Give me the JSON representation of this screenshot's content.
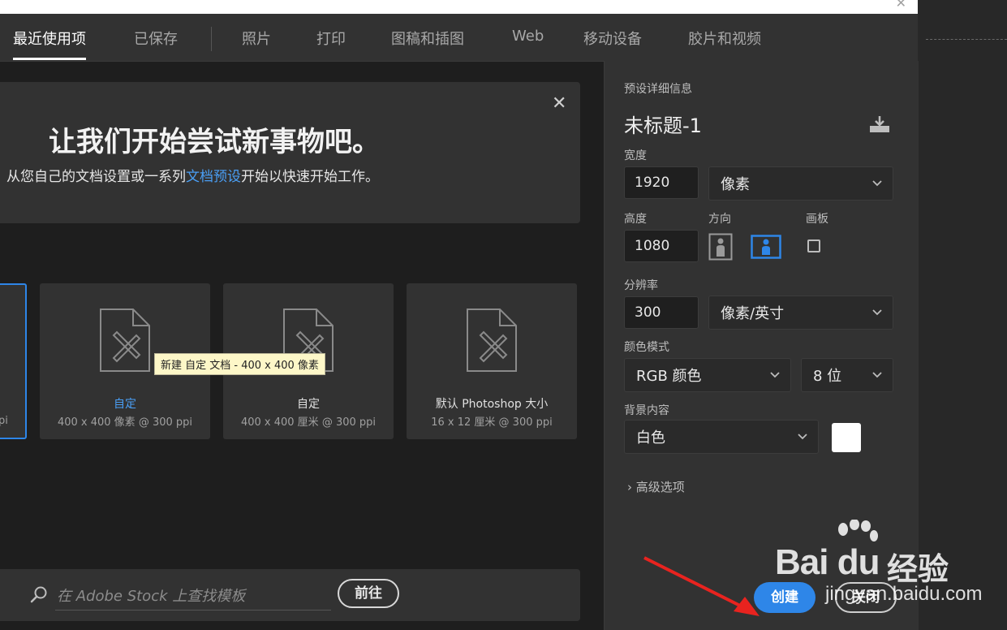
{
  "tabs": [
    {
      "label": "最近使用项",
      "active": true
    },
    {
      "label": "已保存"
    },
    {
      "label": "照片"
    },
    {
      "label": "打印"
    },
    {
      "label": "图稿和插图"
    },
    {
      "label": "Web"
    },
    {
      "label": "移动设备"
    },
    {
      "label": "胶片和视频"
    }
  ],
  "welcome": {
    "title": "让我们开始尝试新事物吧。",
    "subtitle_before": "从您自己的文档设置或一系列",
    "subtitle_link": "文档预设",
    "subtitle_after": "开始以快速开始工作。"
  },
  "presets": [
    {
      "partial_dim": "pi"
    },
    {
      "name": "自定",
      "dim": "400 x 400 像素 @ 300 ppi"
    },
    {
      "name": "自定",
      "dim": "400 x 400 厘米 @ 300 ppi"
    },
    {
      "name": "默认 Photoshop 大小",
      "dim": "16 x 12 厘米 @ 300 ppi"
    }
  ],
  "tooltip": "新建 自定 文档 - 400 x 400 像素",
  "stock": {
    "placeholder": "在 Adobe Stock 上查找模板",
    "go_label": "前往"
  },
  "details": {
    "heading": "预设详细信息",
    "doc_name": "未标题-1",
    "width_label": "宽度",
    "width_value": "1920",
    "width_unit": "像素",
    "height_label": "高度",
    "height_value": "1080",
    "orientation_label": "方向",
    "artboard_label": "画板",
    "resolution_label": "分辨率",
    "resolution_value": "300",
    "resolution_unit": "像素/英寸",
    "color_mode_label": "颜色模式",
    "color_mode_value": "RGB 颜色",
    "bit_depth_value": "8 位",
    "background_label": "背景内容",
    "background_value": "白色",
    "advanced_label": "高级选项"
  },
  "buttons": {
    "create": "创建",
    "close": "关闭"
  },
  "watermark": {
    "brand": "Bai du",
    "cn": "经验",
    "url": "jingyan.baidu.com"
  },
  "colors": {
    "accent": "#2e86e8",
    "link": "#4a9ff5",
    "panel": "#323232",
    "background": "#1e1e1e",
    "annotation_arrow": "#e8231f"
  }
}
